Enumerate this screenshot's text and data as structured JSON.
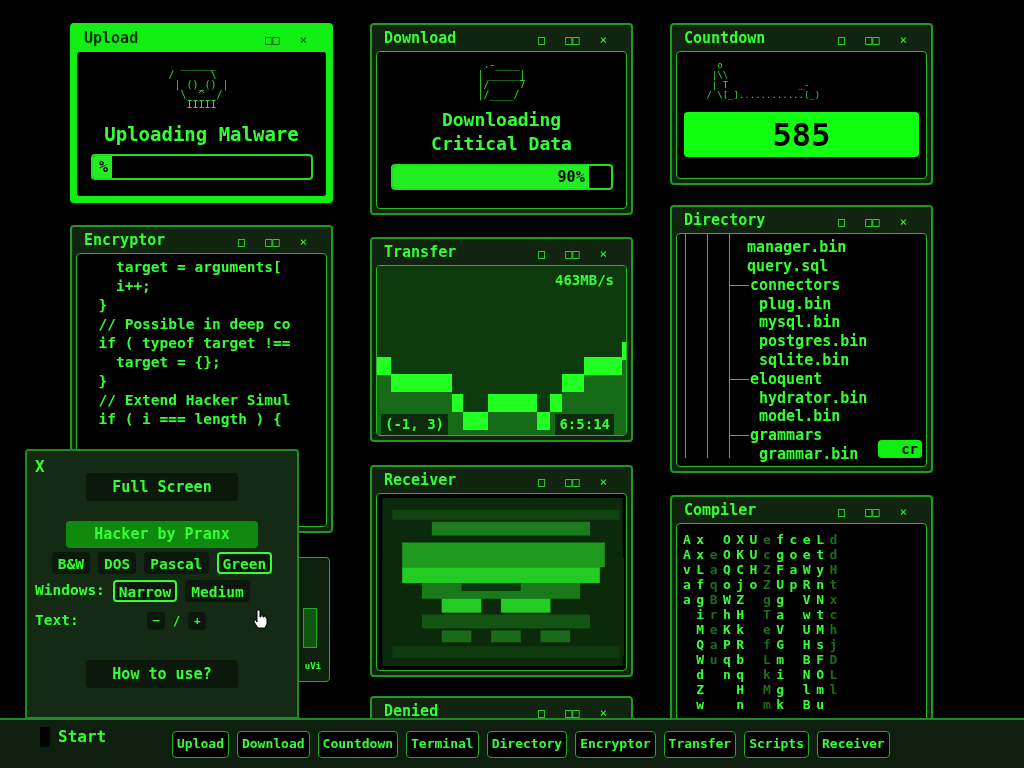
{
  "windows": [
    {
      "kind": "upload",
      "title": "Upload",
      "active": true,
      "controls": [
        "□□",
        "×"
      ],
      "art": [
        "  ______ ",
        "/      \\",
        " | ()_() | ",
        "  \\  ^  / ",
        "   IIIII "
      ],
      "message": "Uploading Malware",
      "progress": {
        "level": 0.09,
        "label": "%"
      }
    },
    {
      "kind": "code",
      "title": "Encryptor",
      "active": false,
      "controls": [
        "□",
        "□□",
        "×"
      ],
      "lines": [
        "    target = arguments[",
        "    i++;",
        "  }",
        "  // Possible in deep co",
        "  if ( typeof target !==",
        "    target = {};",
        "  }",
        "  // Extend Hacker Simul",
        "  if ( i === length ) {"
      ]
    },
    {
      "kind": "download",
      "title": "Download",
      "active": false,
      "controls": [
        "□",
        "□□",
        "×"
      ],
      "art": [
        "  .-____  ",
        " |      | ",
        " |/‾‾‾‾‾7",
        " |/____/ "
      ],
      "message": "Downloading Critical Data",
      "progress": {
        "level": 0.9,
        "label": "90%"
      }
    },
    {
      "kind": "transfer",
      "title": "Transfer",
      "active": false,
      "controls": [
        "□",
        "□□",
        "×"
      ],
      "speed": "463MB/s",
      "coords": "(-1, 3)",
      "clock": "6:5:14"
    },
    {
      "kind": "receiver",
      "title": "Receiver",
      "active": false,
      "controls": [
        "□",
        "□□",
        "×"
      ]
    },
    {
      "kind": "denied",
      "title": "Denied",
      "active": false,
      "controls": [
        "□",
        "□□",
        "×"
      ]
    },
    {
      "kind": "countdown",
      "title": "Countdown",
      "active": false,
      "controls": [
        "□",
        "□□",
        "×"
      ],
      "art": [
        "   o",
        "  |\\\\",
        "  | T             _-",
        " / \\[_]............(_)"
      ],
      "count": "585"
    },
    {
      "kind": "tree",
      "title": "Directory",
      "active": false,
      "controls": [
        "□",
        "□□",
        "×"
      ],
      "tree": [
        {
          "name": "manager.bin"
        },
        {
          "name": "query.sql"
        },
        {
          "name": "connectors",
          "children": [
            {
              "name": "plug.bin"
            },
            {
              "name": "mysql.bin"
            },
            {
              "name": "postgres.bin"
            },
            {
              "name": "sqlite.bin"
            }
          ]
        },
        {
          "name": "eloquent",
          "children": [
            {
              "name": "hydrator.bin"
            },
            {
              "name": "model.bin"
            }
          ]
        },
        {
          "name": "grammars",
          "children": [
            {
              "name": "grammar.bin"
            }
          ]
        }
      ],
      "action": "cr"
    },
    {
      "kind": "matrix",
      "title": "Compiler",
      "active": false,
      "controls": [
        "□",
        "□□",
        "×"
      ],
      "columns": [
        {
          "text": "AAvaa",
          "dim": false
        },
        {
          "text": "xxLfgiMQWdZw",
          "dim": false
        },
        {
          "text": "   eaqBreau",
          "dim": true
        },
        {
          "text": "OOQoWhKPqn",
          "dim": false
        },
        {
          "text": "XKCjZHkRbqHn",
          "dim": false
        },
        {
          "text": "UUHo",
          "dim": false
        },
        {
          "text": "ecZZgTefLkMm",
          "dim": true
        },
        {
          "text": "fgFUgaVGmigk",
          "dim": false
        },
        {
          "text": "coap",
          "dim": false
        },
        {
          "text": "eeWRVwUHBNlB",
          "dim": false
        },
        {
          "text": "LtynNtMsFOmu",
          "dim": false
        },
        {
          "text": "ddHtxchjDLl",
          "dim": true
        }
      ]
    },
    {
      "kind": "hidden",
      "fragment": "uVi"
    }
  ],
  "settings": {
    "close": "X",
    "fullscreen": "Full Screen",
    "brand": "Hacker by Pranx",
    "themes": [
      {
        "label": "B&W",
        "selected": false
      },
      {
        "label": "DOS",
        "selected": false
      },
      {
        "label": "Pascal",
        "selected": false
      },
      {
        "label": "Green",
        "selected": true
      }
    ],
    "windows_label": "Windows:",
    "sizes": [
      {
        "label": "Narrow",
        "selected": true
      },
      {
        "label": "Medium",
        "selected": false
      }
    ],
    "text_label": "Text:",
    "text_controls": [
      {
        "kind": "button",
        "label": "–"
      },
      {
        "kind": "separator",
        "label": "/"
      },
      {
        "kind": "button",
        "label": "+"
      }
    ],
    "help": "How to use?"
  },
  "taskbar": {
    "start": "Start",
    "apps": [
      "Upload",
      "Download",
      "Countdown",
      "Terminal",
      "Directory",
      "Encryptor",
      "Transfer",
      "Scripts",
      "Receiver"
    ]
  }
}
